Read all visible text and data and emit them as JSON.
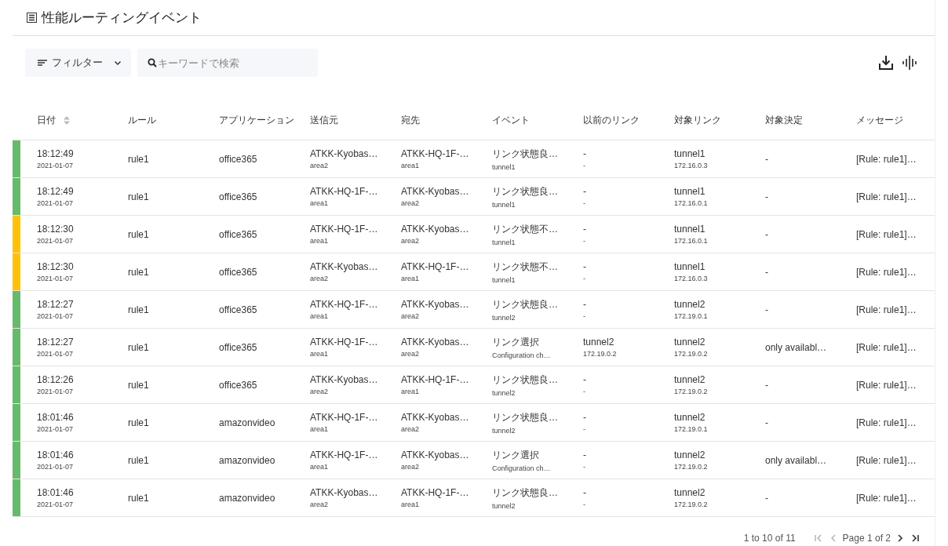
{
  "title": "性能ルーティングイベント",
  "toolbar": {
    "filter_label": "フィルター",
    "search_placeholder": "キーワードで検索"
  },
  "table": {
    "columns": [
      {
        "label": "日付",
        "sortable": true
      },
      {
        "label": "ルール",
        "sortable": false
      },
      {
        "label": "アプリケーション",
        "sortable": false
      },
      {
        "label": "送信元",
        "sortable": false
      },
      {
        "label": "宛先",
        "sortable": false
      },
      {
        "label": "イベント",
        "sortable": false
      },
      {
        "label": "以前のリンク",
        "sortable": false
      },
      {
        "label": "対象リンク",
        "sortable": false
      },
      {
        "label": "対象決定",
        "sortable": false
      },
      {
        "label": "メッセージ",
        "sortable": false
      }
    ],
    "rows": [
      {
        "color": "#66bb6a",
        "cells": [
          {
            "main": "18:12:49",
            "sub": "2021-01-07"
          },
          {
            "main": "rule1"
          },
          {
            "main": "office365"
          },
          {
            "main": "ATKK-Kyobas…",
            "sub": "area2"
          },
          {
            "main": "ATKK-HQ-1F-…",
            "sub": "area1"
          },
          {
            "main": "リンク状態良…",
            "sub": "tunnel1"
          },
          {
            "main": "-",
            "sub": "-"
          },
          {
            "main": "tunnel1",
            "sub": "172.16.0.3"
          },
          {
            "main": "-"
          },
          {
            "main": "[Rule: rule1]…"
          }
        ]
      },
      {
        "color": "#66bb6a",
        "cells": [
          {
            "main": "18:12:49",
            "sub": "2021-01-07"
          },
          {
            "main": "rule1"
          },
          {
            "main": "office365"
          },
          {
            "main": "ATKK-HQ-1F-…",
            "sub": "area1"
          },
          {
            "main": "ATKK-Kyobas…",
            "sub": "area2"
          },
          {
            "main": "リンク状態良…",
            "sub": "tunnel1"
          },
          {
            "main": "-",
            "sub": "-"
          },
          {
            "main": "tunnel1",
            "sub": "172.16.0.1"
          },
          {
            "main": "-"
          },
          {
            "main": "[Rule: rule1]…"
          }
        ]
      },
      {
        "color": "#ffc107",
        "cells": [
          {
            "main": "18:12:30",
            "sub": "2021-01-07"
          },
          {
            "main": "rule1"
          },
          {
            "main": "office365"
          },
          {
            "main": "ATKK-HQ-1F-…",
            "sub": "area1"
          },
          {
            "main": "ATKK-Kyobas…",
            "sub": "area2"
          },
          {
            "main": "リンク状態不…",
            "sub": "tunnel1"
          },
          {
            "main": "-",
            "sub": "-"
          },
          {
            "main": "tunnel1",
            "sub": "172.16.0.1"
          },
          {
            "main": "-"
          },
          {
            "main": "[Rule: rule1]…"
          }
        ]
      },
      {
        "color": "#ffc107",
        "cells": [
          {
            "main": "18:12:30",
            "sub": "2021-01-07"
          },
          {
            "main": "rule1"
          },
          {
            "main": "office365"
          },
          {
            "main": "ATKK-Kyobas…",
            "sub": "area2"
          },
          {
            "main": "ATKK-HQ-1F-…",
            "sub": "area1"
          },
          {
            "main": "リンク状態不…",
            "sub": "tunnel1"
          },
          {
            "main": "-",
            "sub": "-"
          },
          {
            "main": "tunnel1",
            "sub": "172.16.0.3"
          },
          {
            "main": "-"
          },
          {
            "main": "[Rule: rule1]…"
          }
        ]
      },
      {
        "color": "#66bb6a",
        "cells": [
          {
            "main": "18:12:27",
            "sub": "2021-01-07"
          },
          {
            "main": "rule1"
          },
          {
            "main": "office365"
          },
          {
            "main": "ATKK-HQ-1F-…",
            "sub": "area1"
          },
          {
            "main": "ATKK-Kyobas…",
            "sub": "area2"
          },
          {
            "main": "リンク状態良…",
            "sub": "tunnel2"
          },
          {
            "main": "-",
            "sub": "-"
          },
          {
            "main": "tunnel2",
            "sub": "172.19.0.1"
          },
          {
            "main": "-"
          },
          {
            "main": "[Rule: rule1]…"
          }
        ]
      },
      {
        "color": "#66bb6a",
        "cells": [
          {
            "main": "18:12:27",
            "sub": "2021-01-07"
          },
          {
            "main": "rule1"
          },
          {
            "main": "office365"
          },
          {
            "main": "ATKK-HQ-1F-…",
            "sub": "area1"
          },
          {
            "main": "ATKK-Kyobas…",
            "sub": "area2"
          },
          {
            "main": "リンク選択",
            "sub": "Configuration ch…"
          },
          {
            "main": "tunnel2",
            "sub": "172.19.0.2"
          },
          {
            "main": "tunnel2",
            "sub": "172.19.0.2"
          },
          {
            "main": "only availabl…"
          },
          {
            "main": "[Rule: rule1]…"
          }
        ]
      },
      {
        "color": "#66bb6a",
        "cells": [
          {
            "main": "18:12:26",
            "sub": "2021-01-07"
          },
          {
            "main": "rule1"
          },
          {
            "main": "office365"
          },
          {
            "main": "ATKK-Kyobas…",
            "sub": "area2"
          },
          {
            "main": "ATKK-HQ-1F-…",
            "sub": "area1"
          },
          {
            "main": "リンク状態良…",
            "sub": "tunnel2"
          },
          {
            "main": "-",
            "sub": "-"
          },
          {
            "main": "tunnel2",
            "sub": "172.19.0.2"
          },
          {
            "main": "-"
          },
          {
            "main": "[Rule: rule1]…"
          }
        ]
      },
      {
        "color": "#66bb6a",
        "cells": [
          {
            "main": "18:01:46",
            "sub": "2021-01-07"
          },
          {
            "main": "rule1"
          },
          {
            "main": "amazonvideo"
          },
          {
            "main": "ATKK-HQ-1F-…",
            "sub": "area1"
          },
          {
            "main": "ATKK-Kyobas…",
            "sub": "area2"
          },
          {
            "main": "リンク状態良…",
            "sub": "tunnel2"
          },
          {
            "main": "-",
            "sub": "-"
          },
          {
            "main": "tunnel2",
            "sub": "172.19.0.1"
          },
          {
            "main": "-"
          },
          {
            "main": "[Rule: rule1]…"
          }
        ]
      },
      {
        "color": "#66bb6a",
        "cells": [
          {
            "main": "18:01:46",
            "sub": "2021-01-07"
          },
          {
            "main": "rule1"
          },
          {
            "main": "amazonvideo"
          },
          {
            "main": "ATKK-HQ-1F-…",
            "sub": "area1"
          },
          {
            "main": "ATKK-Kyobas…",
            "sub": "area2"
          },
          {
            "main": "リンク選択",
            "sub": "Configuration ch…"
          },
          {
            "main": "-",
            "sub": "-"
          },
          {
            "main": "tunnel2",
            "sub": "172.19.0.2"
          },
          {
            "main": "only availabl…"
          },
          {
            "main": "[Rule: rule1]…"
          }
        ]
      },
      {
        "color": "#66bb6a",
        "cells": [
          {
            "main": "18:01:46",
            "sub": "2021-01-07"
          },
          {
            "main": "rule1"
          },
          {
            "main": "amazonvideo"
          },
          {
            "main": "ATKK-Kyobas…",
            "sub": "area2"
          },
          {
            "main": "ATKK-HQ-1F-…",
            "sub": "area1"
          },
          {
            "main": "リンク状態良…",
            "sub": "tunnel2"
          },
          {
            "main": "-",
            "sub": "-"
          },
          {
            "main": "tunnel2",
            "sub": "172.19.0.2"
          },
          {
            "main": "-"
          },
          {
            "main": "[Rule: rule1]…"
          }
        ]
      }
    ]
  },
  "pagination": {
    "summary": "1 to 10 of 11",
    "page_label": "Page 1 of 2",
    "first": {
      "disabled": true
    },
    "previous": {
      "disabled": true
    },
    "next": {
      "disabled": false
    },
    "last": {
      "disabled": false
    }
  }
}
